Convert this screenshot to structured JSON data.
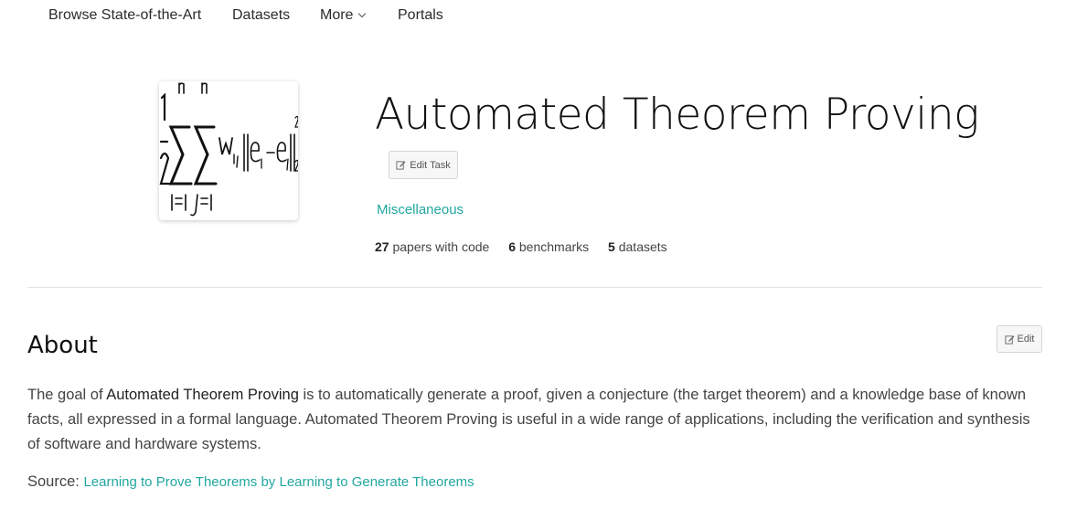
{
  "nav": {
    "browse": "Browse State-of-the-Art",
    "datasets": "Datasets",
    "more": "More",
    "portals": "Portals"
  },
  "task": {
    "title": "Automated Theorem Proving",
    "edit_task_label": "Edit Task",
    "category": "Miscellaneous",
    "stats": {
      "papers_count": "27",
      "papers_label": "papers with code",
      "benchmarks_count": "6",
      "benchmarks_label": "benchmarks",
      "datasets_count": "5",
      "datasets_label": "datasets"
    },
    "image_icon": "math-formula-thumbnail"
  },
  "about": {
    "heading": "About",
    "edit_label": "Edit",
    "text_before": "The goal of ",
    "text_highlight": "Automated Theorem Proving",
    "text_after": " is to automatically generate a proof, given a conjecture (the target theorem) and a knowledge base of known facts, all expressed in a formal language. Automated Theorem Proving is useful in a wide range of applications, including the verification and synthesis of software and hardware systems.",
    "source_label": "Source:",
    "source_link": "Learning to Prove Theorems by Learning to Generate Theorems"
  },
  "colors": {
    "accent": "#21a7a0",
    "text": "#444444",
    "divider": "#e3e3e3"
  }
}
